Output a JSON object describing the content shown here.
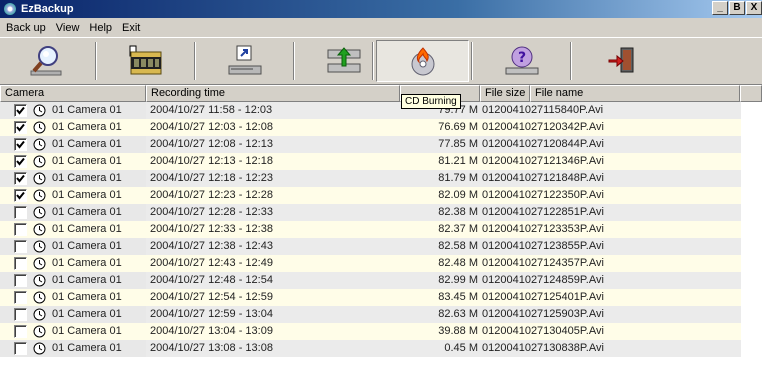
{
  "window": {
    "title": "EzBackup",
    "controls": [
      "_",
      "B",
      "X"
    ]
  },
  "menu": [
    "Back up",
    "View",
    "Help",
    "Exit"
  ],
  "toolbar": {
    "buttons": [
      {
        "name": "search-button",
        "icon": "magnifier-icon"
      },
      {
        "name": "camera-select-button",
        "icon": "film-folder-icon"
      },
      {
        "name": "export-button",
        "icon": "arrow-out-drive-icon"
      },
      {
        "name": "backup-drive-button",
        "icon": "green-arrow-drive-icon"
      },
      {
        "name": "cd-burning-button",
        "icon": "cd-burn-icon",
        "tooltip": "CD Burning"
      },
      {
        "name": "help-button",
        "icon": "question-icon"
      },
      {
        "name": "exit-button",
        "icon": "door-exit-icon"
      }
    ]
  },
  "table": {
    "headers": [
      "Camera",
      "Recording time",
      "",
      "File size",
      "File name"
    ],
    "rows": [
      {
        "checked": true,
        "camera": "01 Camera 01",
        "time": "2004/10/27 11:58 - 12:03",
        "size": "79.77 M",
        "file": "0120041027115840P.Avi"
      },
      {
        "checked": true,
        "camera": "01 Camera 01",
        "time": "2004/10/27 12:03 - 12:08",
        "size": "76.69 M",
        "file": "0120041027120342P.Avi"
      },
      {
        "checked": true,
        "camera": "01 Camera 01",
        "time": "2004/10/27 12:08 - 12:13",
        "size": "77.85 M",
        "file": "0120041027120844P.Avi"
      },
      {
        "checked": true,
        "camera": "01 Camera 01",
        "time": "2004/10/27 12:13 - 12:18",
        "size": "81.21 M",
        "file": "0120041027121346P.Avi"
      },
      {
        "checked": true,
        "camera": "01 Camera 01",
        "time": "2004/10/27 12:18 - 12:23",
        "size": "81.79 M",
        "file": "0120041027121848P.Avi"
      },
      {
        "checked": true,
        "camera": "01 Camera 01",
        "time": "2004/10/27 12:23 - 12:28",
        "size": "82.09 M",
        "file": "0120041027122350P.Avi"
      },
      {
        "checked": false,
        "camera": "01 Camera 01",
        "time": "2004/10/27 12:28 - 12:33",
        "size": "82.38 M",
        "file": "0120041027122851P.Avi"
      },
      {
        "checked": false,
        "camera": "01 Camera 01",
        "time": "2004/10/27 12:33 - 12:38",
        "size": "82.37 M",
        "file": "0120041027123353P.Avi"
      },
      {
        "checked": false,
        "camera": "01 Camera 01",
        "time": "2004/10/27 12:38 - 12:43",
        "size": "82.58 M",
        "file": "0120041027123855P.Avi"
      },
      {
        "checked": false,
        "camera": "01 Camera 01",
        "time": "2004/10/27 12:43 - 12:49",
        "size": "82.48 M",
        "file": "0120041027124357P.Avi"
      },
      {
        "checked": false,
        "camera": "01 Camera 01",
        "time": "2004/10/27 12:48 - 12:54",
        "size": "82.99 M",
        "file": "0120041027124859P.Avi"
      },
      {
        "checked": false,
        "camera": "01 Camera 01",
        "time": "2004/10/27 12:54 - 12:59",
        "size": "83.45 M",
        "file": "0120041027125401P.Avi"
      },
      {
        "checked": false,
        "camera": "01 Camera 01",
        "time": "2004/10/27 12:59 - 13:04",
        "size": "82.63 M",
        "file": "0120041027125903P.Avi"
      },
      {
        "checked": false,
        "camera": "01 Camera 01",
        "time": "2004/10/27 13:04 - 13:09",
        "size": "39.88 M",
        "file": "0120041027130405P.Avi"
      },
      {
        "checked": false,
        "camera": "01 Camera 01",
        "time": "2004/10/27 13:08 - 13:08",
        "size": "0.45 M",
        "file": "0120041027130838P.Avi"
      }
    ]
  }
}
